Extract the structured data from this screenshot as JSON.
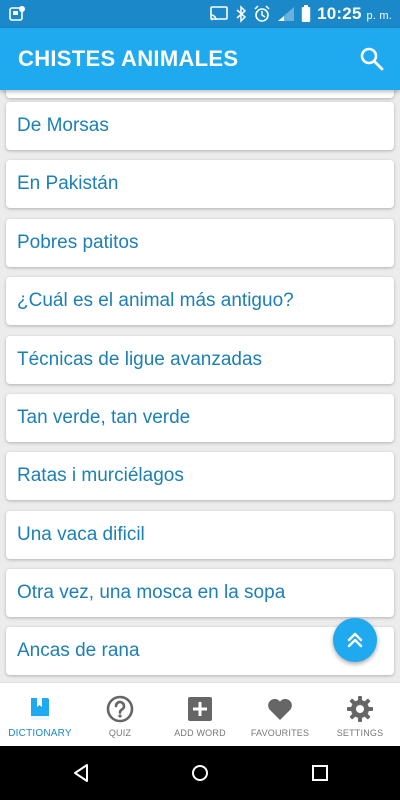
{
  "status_bar": {
    "time": "10:25",
    "ampm": "p. m."
  },
  "app_bar": {
    "title": "CHISTES ANIMALES"
  },
  "jokes": [
    "De Morsas",
    "En Pakistán",
    "Pobres patitos",
    "¿Cuál es el animal más antiguo?",
    "Técnicas de ligue avanzadas",
    "Tan verde, tan verde",
    "Ratas i murciélagos",
    "Una vaca dificil",
    "Otra vez, una mosca en la sopa",
    "Ancas de rana"
  ],
  "bottom_nav": [
    {
      "label": "DICTIONARY",
      "icon": "book-icon",
      "active": true
    },
    {
      "label": "QUIZ",
      "icon": "question-icon",
      "active": false
    },
    {
      "label": "ADD WORD",
      "icon": "add-icon",
      "active": false
    },
    {
      "label": "FAVOURITES",
      "icon": "heart-icon",
      "active": false
    },
    {
      "label": "SETTINGS",
      "icon": "gear-icon",
      "active": false
    }
  ],
  "colors": {
    "primary": "#1fa9ee",
    "status_bar": "#1a88c9",
    "item_text": "#1c7fb5",
    "inactive_icon": "#666666"
  }
}
